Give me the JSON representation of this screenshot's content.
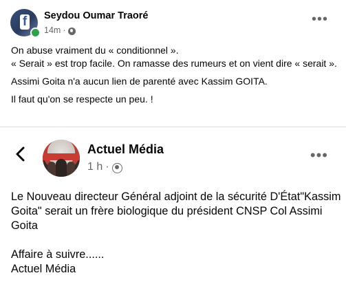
{
  "post": {
    "author": "Seydou Oumar Traoré",
    "time": "14m",
    "separator": "·",
    "audience_icon": "globe-icon",
    "more_label": "•••",
    "paragraphs": [
      "On abuse vraiment du « conditionnel ».",
      "« Serait » est trop facile. On ramasse des rumeurs et on vient dire « serait ».",
      "Assimi Goita n'a aucun lien de parenté avec Kassim GOITA.",
      "Il faut qu'on se respecte un peu. !"
    ]
  },
  "shared_post": {
    "back_icon": "chevron-left-icon",
    "author": "Actuel Média",
    "time": "1 h",
    "separator": "·",
    "audience_icon": "globe-icon",
    "more_label": "•••",
    "paragraph_1": "Le Nouveau directeur Général adjoint de la sécurité D'État\"Kassim Goita\" serait un frère biologique du président CNSP Col Assimi Goita",
    "paragraph_2_line_1": "Affaire à suivre......",
    "paragraph_2_line_2": "Actuel Média"
  },
  "colors": {
    "text": "#050505",
    "secondary": "#65676b",
    "online": "#31a24c",
    "divider": "#dadde1"
  }
}
